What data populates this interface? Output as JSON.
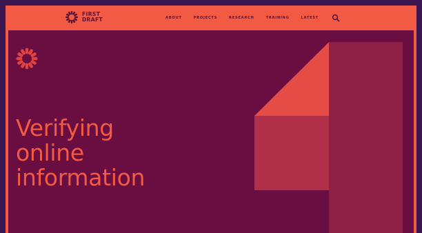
{
  "brand": {
    "line1": "FIRST",
    "line2": "DRAFT",
    "logo_icon": "starburst-icon"
  },
  "nav": {
    "items": [
      {
        "label": "ABOUT"
      },
      {
        "label": "PROJECTS"
      },
      {
        "label": "RESEARCH"
      },
      {
        "label": "TRAINING"
      },
      {
        "label": "LATEST"
      }
    ],
    "search_icon": "search-icon"
  },
  "hero": {
    "headline_lines": [
      "Verifying",
      "online",
      "information"
    ],
    "mark_icon": "starburst-icon"
  },
  "colors": {
    "brand_coral": "#f25a44",
    "hero_plum": "#6a0e42",
    "backdrop_purple": "#3c1650",
    "shape_crimson": "#8e1f45",
    "shape_rose": "#b0304a",
    "shape_red": "#e44c45"
  }
}
